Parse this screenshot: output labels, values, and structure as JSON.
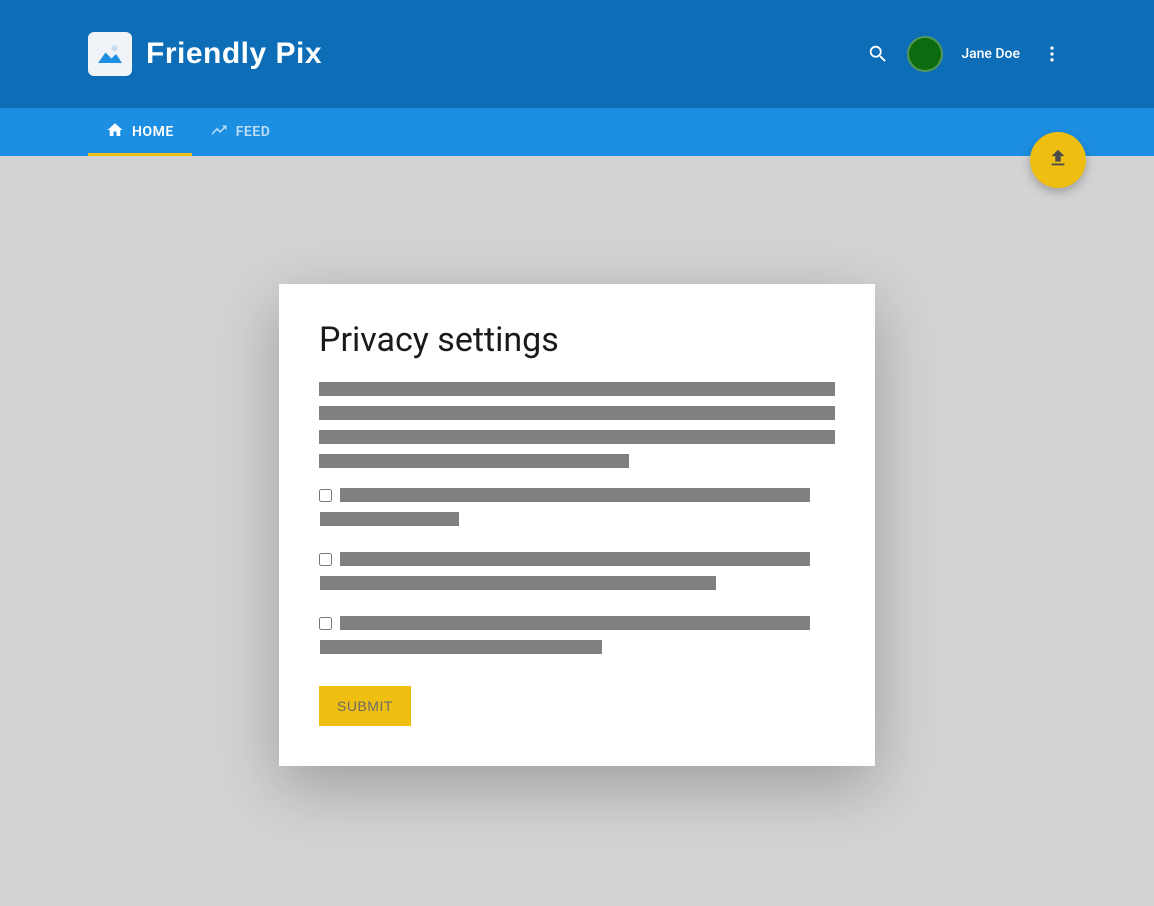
{
  "header": {
    "app_title": "Friendly Pix",
    "username": "Jane Doe"
  },
  "nav": {
    "tabs": [
      {
        "label": "HOME",
        "active": true
      },
      {
        "label": "FEED",
        "active": false
      }
    ]
  },
  "card": {
    "title": "Privacy settings",
    "submit_label": "SUBMIT"
  }
}
